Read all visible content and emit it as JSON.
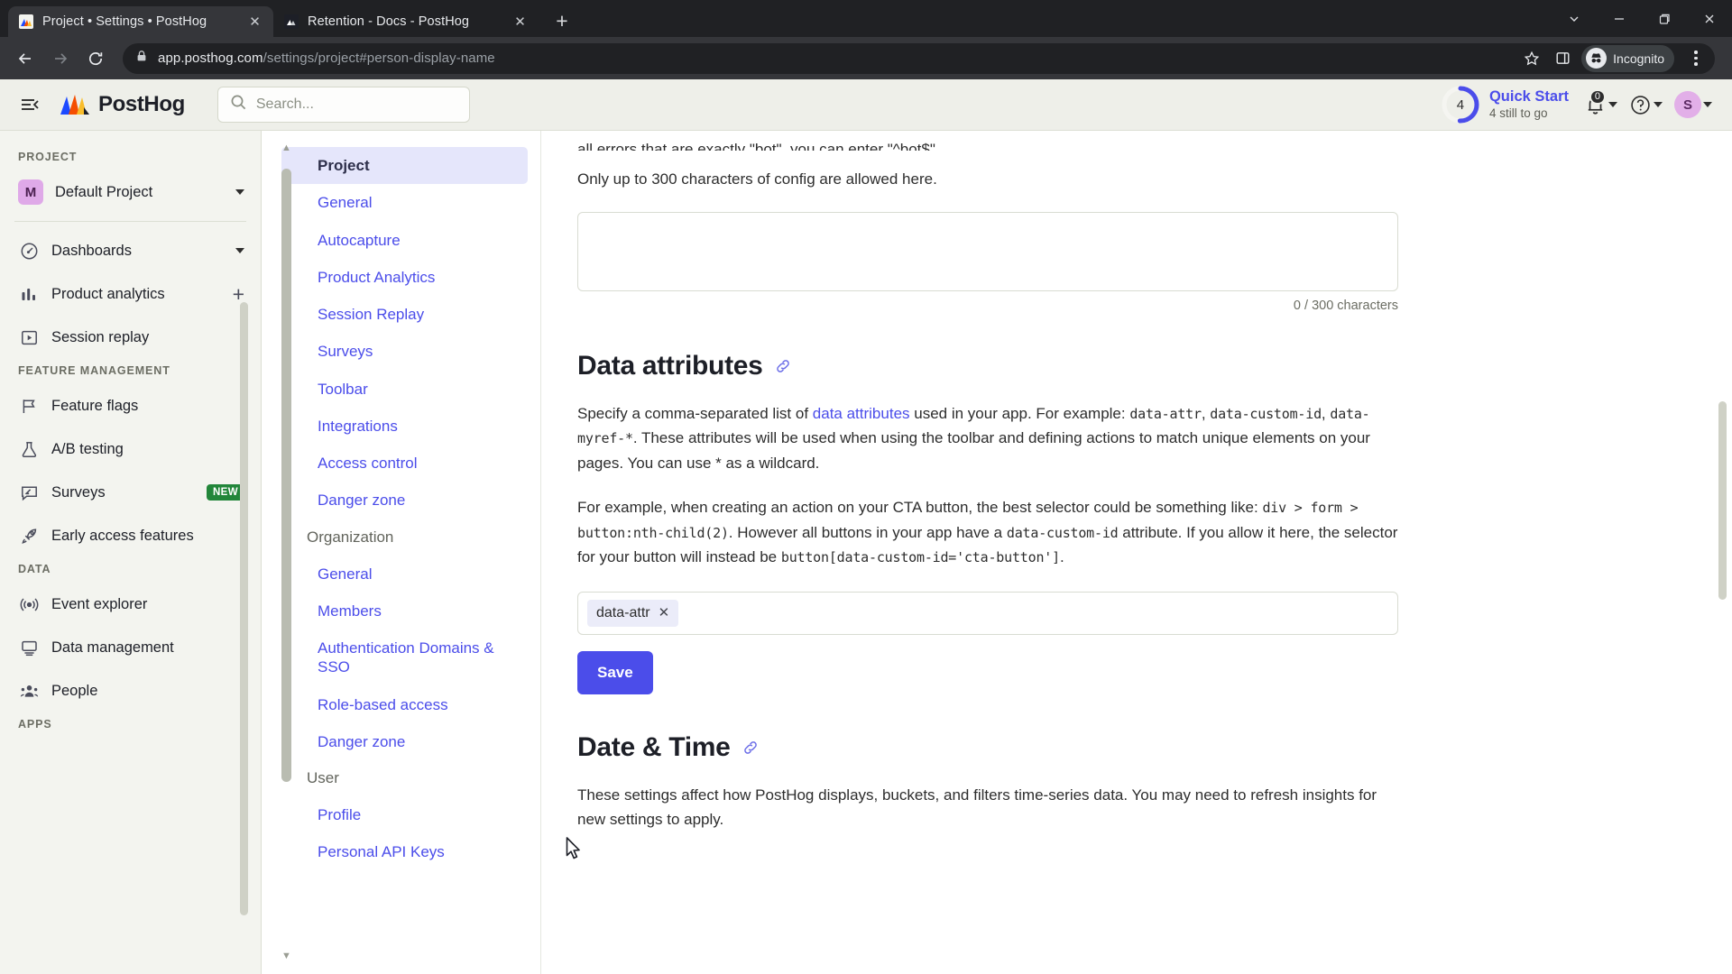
{
  "browser": {
    "tabs": [
      {
        "title": "Project • Settings • PostHog",
        "active": true,
        "close_label": "✕"
      },
      {
        "title": "Retention - Docs - PostHog",
        "active": false,
        "close_label": "✕"
      }
    ],
    "new_tab_label": "+",
    "url_bold": "app.posthog.com",
    "url_rest": "/settings/project#person-display-name",
    "profile_label": "Incognito",
    "window_controls": {
      "minimize": "—",
      "maximize": "❐",
      "close": "✕",
      "chevron": "⌄"
    }
  },
  "header": {
    "logo_text": "PostHog",
    "search_placeholder": "Search...",
    "quick_start": {
      "title": "Quick Start",
      "subtitle": "4 still to go",
      "count": "4",
      "progress_percent": 20,
      "accent": "#4b4dea"
    },
    "notifications_badge": "0",
    "avatar_initial": "S"
  },
  "sidebar": {
    "sections": [
      {
        "label": "PROJECT",
        "items": [
          {
            "label": "Default Project",
            "icon": "project-chip-icon",
            "chip": "M",
            "caret": true
          }
        ]
      },
      {
        "label": "",
        "items": [
          {
            "label": "Dashboards",
            "icon": "gauge-icon",
            "caret": true
          },
          {
            "label": "Product analytics",
            "icon": "bar-chart-icon",
            "plus": true
          },
          {
            "label": "Session replay",
            "icon": "play-square-icon"
          }
        ]
      },
      {
        "label": "FEATURE MANAGEMENT",
        "items": [
          {
            "label": "Feature flags",
            "icon": "flag-icon"
          },
          {
            "label": "A/B testing",
            "icon": "flask-icon"
          },
          {
            "label": "Surveys",
            "icon": "survey-icon",
            "badge": "NEW"
          },
          {
            "label": "Early access features",
            "icon": "rocket-icon"
          }
        ]
      },
      {
        "label": "DATA",
        "items": [
          {
            "label": "Event explorer",
            "icon": "broadcast-icon"
          },
          {
            "label": "Data management",
            "icon": "monitor-icon"
          },
          {
            "label": "People",
            "icon": "people-icon"
          }
        ]
      },
      {
        "label": "APPS",
        "items": []
      }
    ]
  },
  "settings_nav": {
    "groups": [
      {
        "name": "Project",
        "is_active_header": true,
        "items": [
          "General",
          "Autocapture",
          "Product Analytics",
          "Session Replay",
          "Surveys",
          "Toolbar",
          "Integrations",
          "Access control",
          "Danger zone"
        ]
      },
      {
        "name": "Organization",
        "is_active_header": false,
        "items": [
          "General",
          "Members",
          "Authentication Domains & SSO",
          "Role-based access",
          "Danger zone"
        ]
      },
      {
        "name": "User",
        "is_active_header": false,
        "items": [
          "Profile",
          "Personal API Keys"
        ]
      }
    ]
  },
  "main": {
    "clipped_line": "all errors that are exactly \"bot\", you can enter \"^bot$\".",
    "config_limit_text": "Only up to 300 characters of config are allowed here.",
    "textarea_value": "",
    "char_count": "0 / 300 characters",
    "data_attributes": {
      "title": "Data attributes",
      "link_icon": "link-icon",
      "para1_a": "Specify a comma-separated list of ",
      "para1_link": "data attributes",
      "para1_b": " used in your app. For example: ",
      "para1_code1": "data-attr",
      "para1_c": ", ",
      "para1_code2": "data-custom-id",
      "para1_d": ", ",
      "para1_code3": "data-myref-*",
      "para1_e": ". These attributes will be used when using the toolbar and defining actions to match unique elements on your pages. You can use * as a wildcard.",
      "para2_a": "For example, when creating an action on your CTA button, the best selector could be something like: ",
      "para2_code1": "div > form > button:nth-child(2)",
      "para2_b": ". However all buttons in your app have a ",
      "para2_code2": "data-custom-id",
      "para2_c": " attribute. If you allow it here, the selector for your button will instead be ",
      "para2_code3": "button[data-custom-id='cta-button']",
      "para2_d": ".",
      "tags": [
        {
          "label": "data-attr",
          "remove_label": "✕"
        }
      ],
      "save_label": "Save"
    },
    "date_time": {
      "title": "Date & Time",
      "link_icon": "link-icon",
      "description": "These settings affect how PostHog displays, buckets, and filters time-series data. You may need to refresh insights for new settings to apply."
    }
  }
}
